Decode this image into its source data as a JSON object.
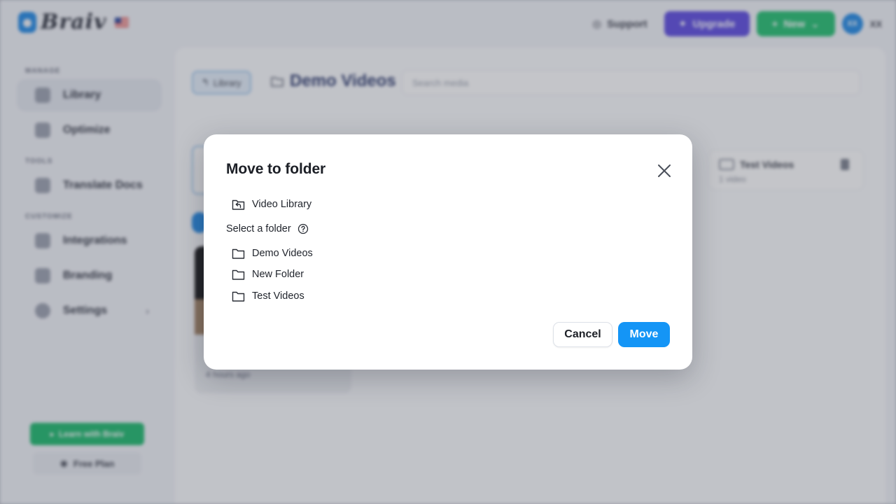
{
  "app": {
    "brand": "Braiv",
    "top_actions": {
      "support_label": "Support",
      "upgrade_label": "Upgrade",
      "new_label": "New",
      "avatar_initials": "XX",
      "extra_label": "XX"
    },
    "sidebar": {
      "sections": [
        {
          "title": "MANAGE",
          "items": [
            {
              "label": "Library",
              "icon": "library-icon",
              "active": true
            },
            {
              "label": "Optimize",
              "icon": "optimize-icon"
            }
          ]
        },
        {
          "title": "TOOLS",
          "items": [
            {
              "label": "Translate Docs",
              "icon": "document-icon"
            }
          ]
        },
        {
          "title": "CUSTOMIZE",
          "items": [
            {
              "label": "Integrations",
              "icon": "link-icon"
            },
            {
              "label": "Branding",
              "icon": "branding-icon"
            },
            {
              "label": "Settings",
              "icon": "gear-icon"
            }
          ]
        }
      ],
      "learn_label": "Learn with Braiv",
      "plan_label": "Free Plan"
    },
    "main": {
      "breadcrumb_back_label": "Library",
      "folder_title": "Demo Videos",
      "search_placeholder": "Search media",
      "folder_card": {
        "name": "Test Videos",
        "count": "1 video"
      },
      "video_card": {
        "time": "4 hours ago"
      }
    }
  },
  "modal": {
    "title": "Move to folder",
    "root_label": "Video Library",
    "select_label": "Select a folder",
    "folders": [
      "Demo Videos",
      "New Folder",
      "Test Videos"
    ],
    "cancel_label": "Cancel",
    "move_label": "Move"
  },
  "colors": {
    "primary": "#1495f6",
    "upgrade": "#5a48e0",
    "new": "#1fbf6e"
  }
}
